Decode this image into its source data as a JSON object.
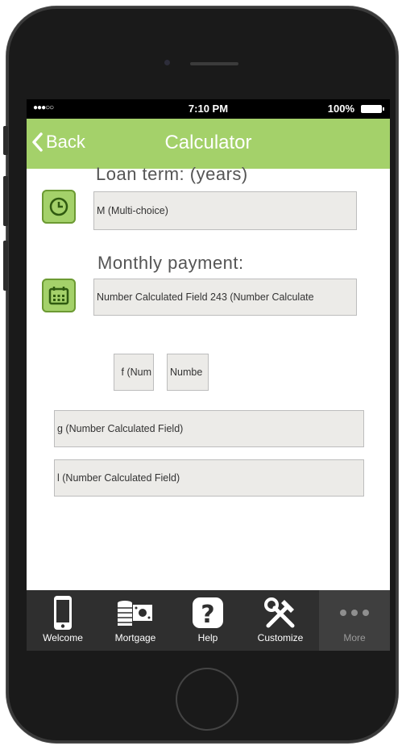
{
  "status_bar": {
    "signal": "●●●○○",
    "time": "7:10 PM",
    "battery": "100%"
  },
  "nav": {
    "back_label": "Back",
    "title": "Calculator"
  },
  "form": {
    "loan_term_label": "Loan term: (years)",
    "loan_term_value": "M (Multi-choice)",
    "monthly_payment_label": "Monthly payment:",
    "monthly_payment_value": "Number Calculated Field 243 (Number Calculate",
    "small_field_1": "f (Num",
    "small_field_2": "Numbe",
    "field_g": "g (Number Calculated Field)",
    "field_l": "l (Number Calculated Field)"
  },
  "tabs": [
    {
      "label": "Welcome",
      "icon": "phone-icon"
    },
    {
      "label": "Mortgage",
      "icon": "money-icon"
    },
    {
      "label": "Help",
      "icon": "help-icon"
    },
    {
      "label": "Customize",
      "icon": "tools-icon"
    },
    {
      "label": "More",
      "icon": "more-icon"
    }
  ],
  "colors": {
    "accent": "#a4d16a",
    "accent_dark": "#6c9a33",
    "tabbar": "#2f2f2f"
  }
}
